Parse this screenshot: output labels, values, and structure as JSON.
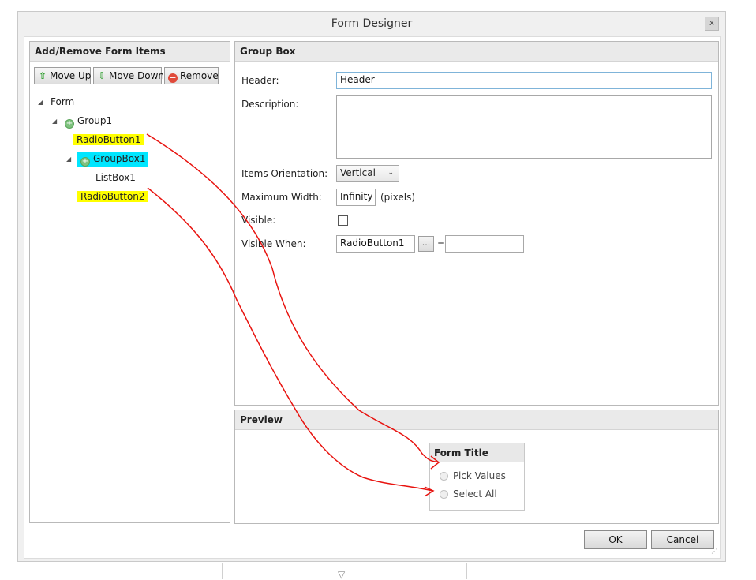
{
  "dialog": {
    "title": "Form Designer",
    "close_label": "x"
  },
  "left_panel": {
    "header": "Add/Remove Form Items",
    "toolbar": {
      "move_up": "Move Up",
      "move_down": "Move Down",
      "remove": "Remove"
    },
    "tree": {
      "root": "Form",
      "group1": "Group1",
      "radio1": "RadioButton1",
      "groupbox1": "GroupBox1",
      "listbox1": "ListBox1",
      "radio2": "RadioButton2"
    }
  },
  "properties": {
    "header": "Group Box",
    "header_label": "Header:",
    "header_value": "Header",
    "description_label": "Description:",
    "description_value": "",
    "orientation_label": "Items Orientation:",
    "orientation_value": "Vertical",
    "max_width_label": "Maximum Width:",
    "max_width_value": "Infinity",
    "max_width_unit": "(pixels)",
    "visible_label": "Visible:",
    "visible_checked": false,
    "visible_when_label": "Visible When:",
    "visible_when_value": "RadioButton1",
    "ellipsis": "...",
    "equals": "=",
    "visible_when_compare": ""
  },
  "preview": {
    "header": "Preview",
    "form_title": "Form Title",
    "options": [
      "Pick Values",
      "Select All"
    ]
  },
  "buttons": {
    "ok": "OK",
    "cancel": "Cancel"
  },
  "colors": {
    "highlight_yellow": "#ffff00",
    "highlight_cyan": "#00e6ff",
    "annotation_red": "#e8130f"
  }
}
